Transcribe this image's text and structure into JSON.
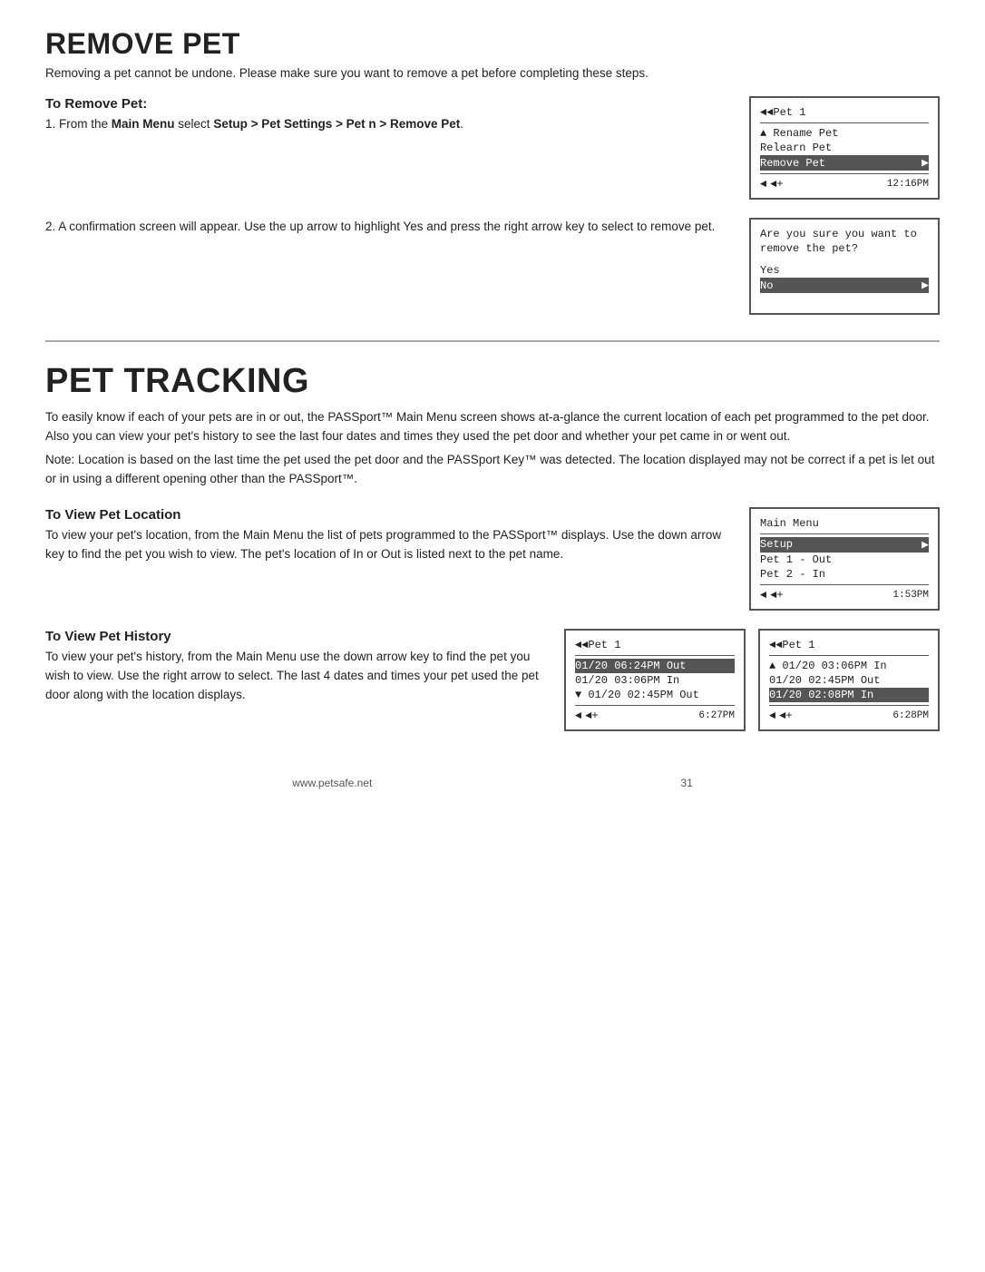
{
  "remove_pet": {
    "title": "REMOVE PET",
    "subtitle": "Removing a pet cannot be undone. Please make sure you want to remove a pet before completing these steps.",
    "subsection_title": "To Remove Pet:",
    "step1_a": "1.  From the ",
    "step1_bold1": "Main Menu",
    "step1_b": " select ",
    "step1_bold2": "Setup > Pet Settings > Pet n > Remove Pet",
    "step1_c": ".",
    "step2": "2.  A confirmation screen will appear. Use the up arrow to highlight Yes and press the right arrow key to select to remove pet.",
    "screen1": {
      "header": "◄◄Pet 1",
      "rows": [
        {
          "text": "▲ Rename Pet",
          "highlighted": false
        },
        {
          "text": "  Relearn Pet",
          "highlighted": false
        },
        {
          "text": "  Remove Pet",
          "highlighted": true,
          "arrow": true
        }
      ],
      "footer_left1": "◄",
      "footer_left2": "◄+",
      "footer_time": "12:16PM"
    },
    "screen2": {
      "prompt1": "Are you sure you want to",
      "prompt2": "remove the pet?",
      "yes": "  Yes",
      "no": "  No",
      "no_arrow": true
    }
  },
  "pet_tracking": {
    "title": "PET TRACKING",
    "intro": "To easily know if each of your pets are in or out, the PASSport™ Main Menu screen shows at-a-glance the current location of each pet programmed to the pet door.  Also you can view your pet's history to see the last four dates and times they used the pet door and whether your pet came in or went out.",
    "note": "Note: Location is based on the last time the pet used the pet door and the PASSport Key™ was detected. The location displayed may not be correct if a pet is let out or in using a different opening other than the PASSport™.",
    "location_title": "To View Pet Location",
    "location_text": "To view your pet's location, from the Main Menu the list of pets programmed to the PASSport™ displays. Use the down arrow key to find the pet you wish to view. The pet's location of In or Out is listed next to the pet name.",
    "screen_location": {
      "header": "Main Menu",
      "rows": [
        {
          "text": "Setup",
          "highlighted": true,
          "arrow": true
        },
        {
          "text": "Pet 1 - Out",
          "highlighted": false
        },
        {
          "text": "Pet 2 - In",
          "highlighted": false
        }
      ],
      "footer_left1": "◄",
      "footer_left2": "◄+",
      "footer_time": "1:53PM"
    },
    "history_title": "To View Pet History",
    "history_text": "To view your pet's history, from the Main Menu use the down arrow key to find the pet you wish to view. Use the right arrow to select. The last 4 dates and times your pet used the pet door along with the location displays.",
    "screen_history1": {
      "header": "◄◄Pet 1",
      "rows": [
        {
          "text": "  01/20  06:24PM  Out",
          "highlighted": true
        },
        {
          "text": "  01/20  03:06PM  In",
          "highlighted": false
        },
        {
          "text": "▼ 01/20  02:45PM  Out",
          "highlighted": false
        }
      ],
      "footer_left1": "◄",
      "footer_left2": "◄+",
      "footer_time": "6:27PM"
    },
    "screen_history2": {
      "header": "◄◄Pet 1",
      "rows": [
        {
          "text": "▲ 01/20  03:06PM  In",
          "highlighted": false
        },
        {
          "text": "  01/20  02:45PM  Out",
          "highlighted": false
        },
        {
          "text": "  01/20  02:08PM  In",
          "highlighted": true
        }
      ],
      "footer_left1": "◄",
      "footer_left2": "◄+",
      "footer_time": "6:28PM"
    }
  },
  "footer": {
    "url": "www.petsafe.net",
    "page": "31"
  }
}
